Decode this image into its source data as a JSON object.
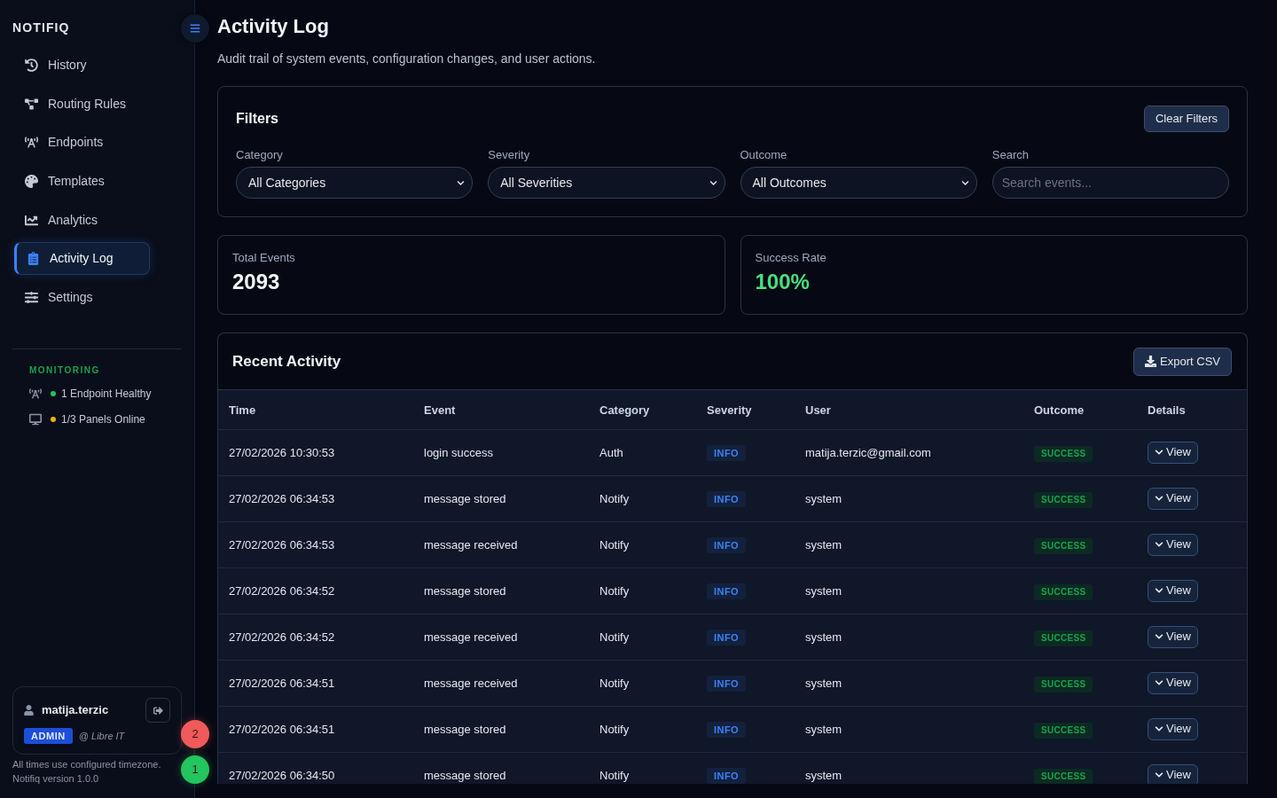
{
  "sidebar": {
    "brand": "NOTIFIQ",
    "nav": [
      {
        "label": "History",
        "selected": false
      },
      {
        "label": "Routing Rules",
        "selected": false
      },
      {
        "label": "Endpoints",
        "selected": false
      },
      {
        "label": "Templates",
        "selected": false
      },
      {
        "label": "Analytics",
        "selected": false
      },
      {
        "label": "Activity Log",
        "selected": true
      },
      {
        "label": "Settings",
        "selected": false
      }
    ],
    "monitoring": {
      "title": "MONITORING",
      "items": [
        {
          "label": "1 Endpoint Healthy",
          "color": "#22c55e"
        },
        {
          "label": "1/3 Panels Online",
          "color": "#eab308"
        }
      ]
    },
    "user": {
      "name": "matija.terzic",
      "role": "ADMIN",
      "org": "@ Libre IT"
    },
    "footer": [
      "All times use configured timezone.",
      "Notifiq version 1.0.0"
    ]
  },
  "floating_badges": [
    {
      "label": "2",
      "color": "#f05a5a"
    },
    {
      "label": "1",
      "color": "#22c55e"
    }
  ],
  "page": {
    "title": "Activity Log",
    "subtitle": "Audit trail of system events, configuration changes, and user actions."
  },
  "filters": {
    "title": "Filters",
    "clear_button": "Clear Filters",
    "fields": [
      {
        "kind": "select",
        "label": "Category",
        "value": "All Categories"
      },
      {
        "kind": "select",
        "label": "Severity",
        "value": "All Severities"
      },
      {
        "kind": "select",
        "label": "Outcome",
        "value": "All Outcomes"
      },
      {
        "kind": "search",
        "label": "Search",
        "placeholder": "Search events..."
      }
    ]
  },
  "stats": [
    {
      "kind": "plain",
      "label": "Total Events",
      "value": "2093"
    },
    {
      "kind": "success",
      "label": "Success Rate",
      "value": "100%"
    }
  ],
  "activity": {
    "title": "Recent Activity",
    "export_button": "Export CSV",
    "table": {
      "columns": [
        "Time",
        "Event",
        "Category",
        "Severity",
        "User",
        "Outcome",
        "Details"
      ],
      "rows": [
        {
          "time": "27/02/2026 10:30:53",
          "event": "login success",
          "category": "Auth",
          "severity": "INFO",
          "user": "matija.terzic@gmail.com",
          "outcome": "SUCCESS",
          "details": "View"
        },
        {
          "time": "27/02/2026 06:34:53",
          "event": "message stored",
          "category": "Notify",
          "severity": "INFO",
          "user": "system",
          "outcome": "SUCCESS",
          "details": "View"
        },
        {
          "time": "27/02/2026 06:34:53",
          "event": "message received",
          "category": "Notify",
          "severity": "INFO",
          "user": "system",
          "outcome": "SUCCESS",
          "details": "View"
        },
        {
          "time": "27/02/2026 06:34:52",
          "event": "message stored",
          "category": "Notify",
          "severity": "INFO",
          "user": "system",
          "outcome": "SUCCESS",
          "details": "View"
        },
        {
          "time": "27/02/2026 06:34:52",
          "event": "message received",
          "category": "Notify",
          "severity": "INFO",
          "user": "system",
          "outcome": "SUCCESS",
          "details": "View"
        },
        {
          "time": "27/02/2026 06:34:51",
          "event": "message received",
          "category": "Notify",
          "severity": "INFO",
          "user": "system",
          "outcome": "SUCCESS",
          "details": "View"
        },
        {
          "time": "27/02/2026 06:34:51",
          "event": "message stored",
          "category": "Notify",
          "severity": "INFO",
          "user": "system",
          "outcome": "SUCCESS",
          "details": "View"
        },
        {
          "time": "27/02/2026 06:34:50",
          "event": "message stored",
          "category": "Notify",
          "severity": "INFO",
          "user": "system",
          "outcome": "SUCCESS",
          "details": "View"
        }
      ]
    }
  }
}
